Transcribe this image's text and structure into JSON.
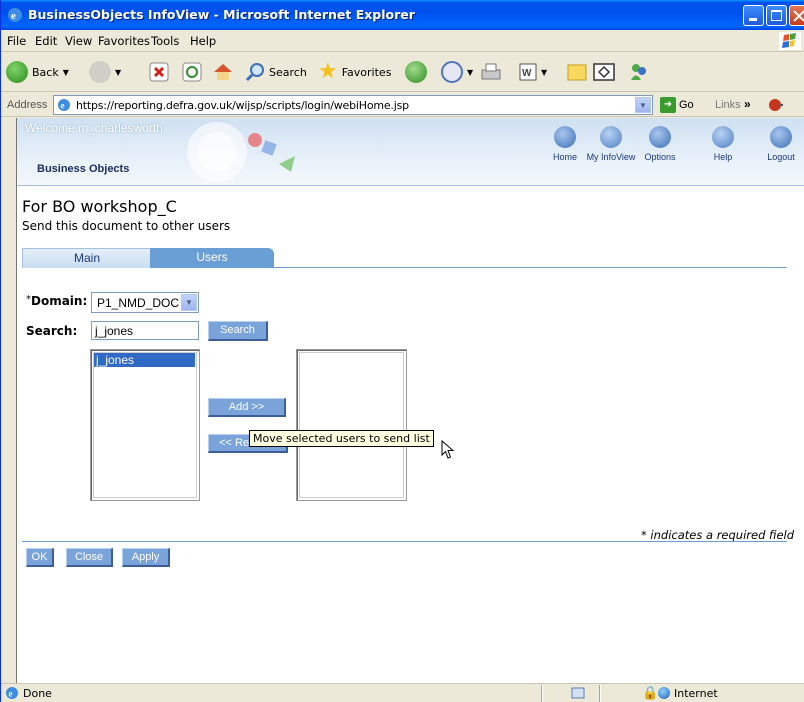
{
  "window": {
    "title": "BusinessObjects InfoView - Microsoft Internet Explorer"
  },
  "menu": [
    "File",
    "Edit",
    "View",
    "Favorites",
    "Tools",
    "Help"
  ],
  "toolbar": {
    "back_label": "Back",
    "search_label": "Search",
    "favorites_label": "Favorites"
  },
  "address": {
    "label": "Address",
    "url": "https://reporting.defra.gov.uk/wijsp/scripts/login/webiHome.jsp",
    "go_label": "Go",
    "links_label": "Links"
  },
  "bo": {
    "welcome": "Welcome m_charlesworth",
    "logo_word1": "Business",
    "logo_word2": "Objects",
    "nav": [
      {
        "label": "Home",
        "icon": "home-icon",
        "color": "#3b6fb6"
      },
      {
        "label": "My InfoView",
        "icon": "infoview-icon",
        "color": "#4c7fc4"
      },
      {
        "label": "Options",
        "icon": "options-icon",
        "color": "#3b6fb6"
      },
      {
        "label": "Help",
        "icon": "help-icon",
        "color": "#4c7fc4"
      },
      {
        "label": "Logout",
        "icon": "logout-icon",
        "color": "#3b6fb6"
      }
    ]
  },
  "page": {
    "title": "For BO workshop_C",
    "subtitle": "Send this document to other users",
    "tabs": [
      {
        "label": "Main",
        "active": false
      },
      {
        "label": "Users",
        "active": true
      }
    ]
  },
  "form": {
    "required_mark": "*",
    "domain_label": "Domain:",
    "domain_value": "P1_NMD_DOC",
    "search_label": "Search:",
    "search_value": "j_jones",
    "search_button": "Search",
    "available_users": [
      "j_jones"
    ],
    "selected_users": [],
    "add_button": "Add >>",
    "remove_button": "<< Remove",
    "tooltip": "Move selected users to send list",
    "required_note": "* indicates a required field",
    "ok_button": "OK",
    "close_button": "Close",
    "apply_button": "Apply"
  },
  "status": {
    "text": "Done",
    "zone": "Internet"
  },
  "colors": {
    "titlebar": "#0053ee",
    "bo_button": "#7aa4d9",
    "selection": "#316ac5",
    "tab_active": "#6a9fd6"
  }
}
